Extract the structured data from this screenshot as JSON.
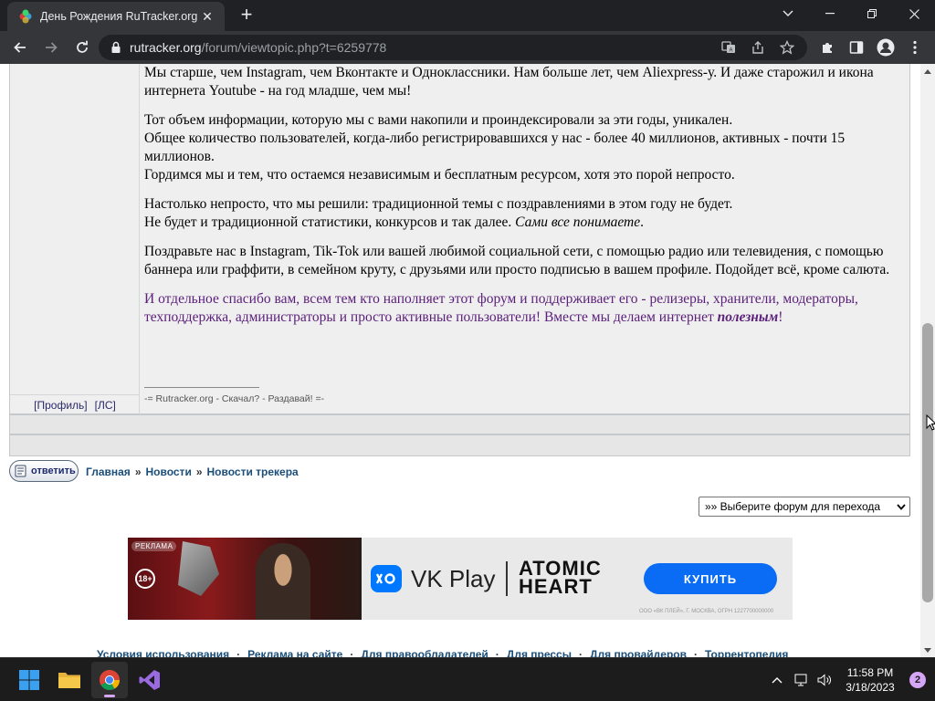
{
  "browser": {
    "tab_title": "День Рождения RuTracker.org -",
    "url_host": "rutracker.org",
    "url_path": "/forum/viewtopic.php?t=6259778"
  },
  "post": {
    "paragraphs": [
      "Мы старше, чем Instagram, чем Вконтакте и Одноклассники. Нам больше лет, чем Aliexpress-у. И даже старожил и икона интернета Youtube - на год младше, чем мы!",
      "Тот объем информации, которую мы с вами накопили и проиндексировали за эти годы, уникален.",
      "Общее количество пользователей, когда-либо регистрировавшихся у нас - более 40 миллионов, активных - почти 15 миллионов.",
      "Гордимся мы и тем, что остаемся независимым и бесплатным ресурсом, хотя это порой непросто.",
      "Настолько непросто, что мы решили: традиционной темы с поздравлениями в этом году не будет.",
      "Не будет и традиционной статистики, конкурсов и так далее. ",
      "Сами все понимаете",
      ".",
      "Поздравьте нас в Instagram, Tik-Tok или вашей любимой социальной сети, с помощью радио или телевидения, с помощью баннера или граффити, в семейном круту, с друзьями или просто подписью в вашем профиле. Подойдет всё, кроме салюта.",
      "И отдельное спасибо вам, всем тем кто наполняет этот форум и поддерживает его - релизеры, хранители, модераторы, техподдержка, администраторы и просто активные пользователи! Вместе мы делаем интернет ",
      "полезным",
      "!"
    ],
    "signature": "-= Rutracker.org - Скачал? - Раздавай! =-",
    "profile_link": "[Профиль]",
    "pm_link": "[ЛС]"
  },
  "actions": {
    "reply_label": "ответить"
  },
  "breadcrumb": {
    "items": [
      "Главная",
      "Новости",
      "Новости трекера"
    ],
    "separator": "»"
  },
  "forum_jump": {
    "selected": "»» Выберите форум для перехода"
  },
  "ad": {
    "label": "РЕКЛАМА",
    "age": "18+",
    "vk_play": "VK Play",
    "game_title": "ATOMIC\nHEART",
    "buy_label": "КУПИТЬ",
    "legal": "ООО «ВК ПЛЕЙ», Г. МОСКВА, ОГРН 1227700000000"
  },
  "footer": {
    "links": [
      "Условия использования",
      "Реклама на сайте",
      "Для правообладателей",
      "Для прессы",
      "Для провайдеров",
      "Торрентопедия"
    ],
    "separator": "·"
  },
  "taskbar": {
    "time": "11:58 PM",
    "date": "3/18/2023",
    "notifications": "2"
  },
  "colors": {
    "link": "#1a4e7a",
    "thanks_text": "#5a1f7a",
    "post_bg": "#efefef",
    "chrome_bg": "#35363a",
    "buy_button": "#0a6cf5"
  }
}
